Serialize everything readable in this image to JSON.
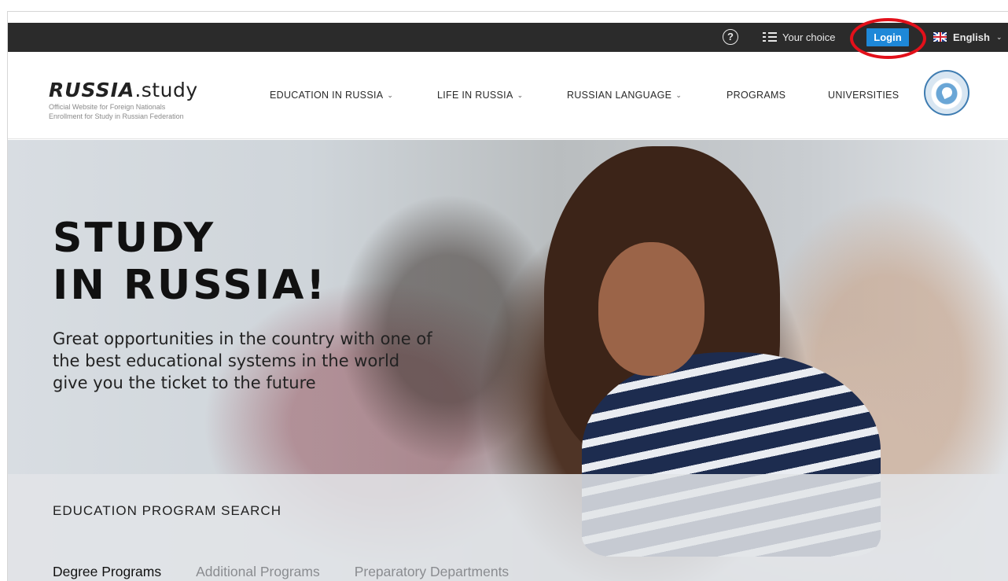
{
  "topbar": {
    "help_icon": "question-circle-icon",
    "your_choice": "Your choice",
    "login": "Login",
    "language": "English",
    "highlight_color": "#e3101a",
    "login_color": "#1e88d8"
  },
  "header": {
    "logo_text": ".study",
    "logo_mark": "RUSSIA",
    "logo_sub_1": "Official Website for Foreign Nationals",
    "logo_sub_2": "Enrollment for Study in Russian Federation",
    "nav": [
      {
        "label": "EDUCATION IN RUSSIA",
        "dropdown": true
      },
      {
        "label": "LIFE IN RUSSIA",
        "dropdown": true
      },
      {
        "label": "RUSSIAN LANGUAGE",
        "dropdown": true
      },
      {
        "label": "PROGRAMS",
        "dropdown": false
      },
      {
        "label": "UNIVERSITIES",
        "dropdown": false
      }
    ],
    "emblem": "rossotrudnichestvo-emblem"
  },
  "hero": {
    "title": "STUDY\nIN RUSSIA!",
    "subtitle": "Great opportunities in the country with one of the best educational systems in the world give you the ticket to the future"
  },
  "search": {
    "title": "EDUCATION PROGRAM SEARCH",
    "tabs": [
      {
        "label": "Degree Programs",
        "active": true
      },
      {
        "label": "Additional Programs",
        "active": false
      },
      {
        "label": "Preparatory Departments",
        "active": false
      }
    ]
  }
}
